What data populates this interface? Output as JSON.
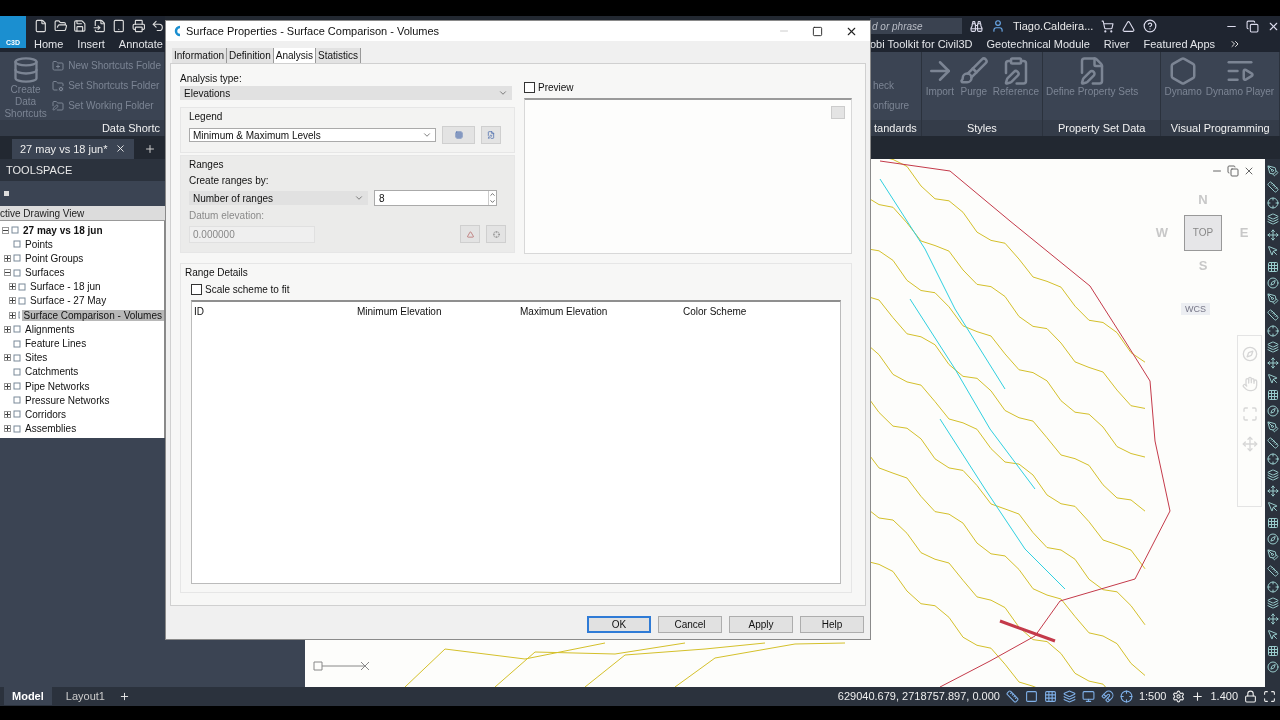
{
  "app": {
    "logo": "C3D",
    "ribbon_tabs_left": [
      {
        "label": "Home",
        "selected": false
      },
      {
        "label": "Insert",
        "selected": false
      },
      {
        "label": "Annotate",
        "selected": false
      }
    ],
    "search": {
      "placeholder": "d or phrase"
    },
    "user": "Tiago.Caldeira...",
    "ribbon_tabs_right": [
      {
        "label": "obi Toolkit for Civil3D",
        "selected": false
      },
      {
        "label": "Geotechnical Module",
        "selected": false
      },
      {
        "label": "River",
        "selected": false
      },
      {
        "label": "Featured Apps",
        "selected": false
      }
    ],
    "panel_left": {
      "title": "Data Shortc",
      "large": [
        {
          "label": "Create Data Shortcuts",
          "disabled": true
        }
      ],
      "small": [
        {
          "label": "New Shortcuts Folde",
          "disabled": true
        },
        {
          "label": "Set Shortcuts Folder",
          "disabled": true
        },
        {
          "label": "Set Working Folder",
          "disabled": true
        }
      ]
    },
    "panels_right": [
      {
        "title": "tandards",
        "kind": "small",
        "commands": [
          {
            "label": "heck",
            "disabled": true
          },
          {
            "label": "onfigure",
            "disabled": true
          }
        ]
      },
      {
        "title": "Styles",
        "kind": "large",
        "commands": [
          {
            "label": "Import",
            "disabled": true
          },
          {
            "label": "Purge",
            "disabled": true
          },
          {
            "label": "Reference",
            "disabled": true
          }
        ]
      },
      {
        "title": "Property Set Data",
        "kind": "large",
        "commands": [
          {
            "label": "Define Property Sets",
            "disabled": true
          }
        ]
      },
      {
        "title": "Visual Programming",
        "kind": "large",
        "commands": [
          {
            "label": "Dynamo",
            "disabled": true
          },
          {
            "label": "Dynamo Player",
            "disabled": true
          }
        ]
      }
    ]
  },
  "document_tabs": [
    {
      "label": "27 may vs 18 jun*",
      "selected": true
    }
  ],
  "toolspace": {
    "title": "TOOLSPACE",
    "view": "ctive Drawing View",
    "tree": [
      {
        "label": "27 may vs 18 jun",
        "selected": false,
        "expanded": true,
        "children": [
          {
            "label": "Points",
            "selected": false
          },
          {
            "label": "Point Groups",
            "selected": false,
            "expanded": false
          },
          {
            "label": "Surfaces",
            "selected": false,
            "expanded": true,
            "children": [
              {
                "label": "Surface - 18 jun",
                "selected": false,
                "expanded": false
              },
              {
                "label": "Surface - 27 May",
                "selected": false,
                "expanded": false
              },
              {
                "label": "Surface Comparison - Volumes",
                "selected": true,
                "expanded": false
              }
            ]
          },
          {
            "label": "Alignments",
            "selected": false,
            "expanded": false
          },
          {
            "label": "Feature Lines",
            "selected": false
          },
          {
            "label": "Sites",
            "selected": false,
            "expanded": false
          },
          {
            "label": "Catchments",
            "selected": false
          },
          {
            "label": "Pipe Networks",
            "selected": false,
            "expanded": false
          },
          {
            "label": "Pressure Networks",
            "selected": false
          },
          {
            "label": "Corridors",
            "selected": false,
            "expanded": false
          },
          {
            "label": "Assemblies",
            "selected": false,
            "expanded": false
          }
        ]
      }
    ]
  },
  "viewcube": {
    "north": "N",
    "west": "W",
    "east": "E",
    "south": "S",
    "face": "TOP",
    "ucs": "WCS"
  },
  "layout_tabs": [
    {
      "label": "Model",
      "selected": true
    },
    {
      "label": "Layout1",
      "selected": false
    }
  ],
  "status_bar": {
    "coordinates": "629040.679, 2718757.897, 0.000",
    "scale": "1:500",
    "readout": "1.400"
  },
  "dialog": {
    "title": "Surface Properties - Surface Comparison - Volumes",
    "tabs": [
      {
        "label": "Information",
        "selected": false
      },
      {
        "label": "Definition",
        "selected": false
      },
      {
        "label": "Analysis",
        "selected": true
      },
      {
        "label": "Statistics",
        "selected": false
      }
    ],
    "analysis_type": {
      "label": "Analysis type:",
      "value": "Elevations"
    },
    "legend": {
      "label": "Legend",
      "value": "Minimum & Maximum Levels"
    },
    "ranges": {
      "label": "Ranges",
      "create_by_label": "Create ranges by:",
      "create_by_value": "Number of ranges",
      "count": "8",
      "datum_label": "Datum elevation:",
      "datum_value": "0.000000",
      "datum_disabled": true
    },
    "preview": {
      "label": "Preview",
      "checked": false
    },
    "range_details": {
      "label": "Range Details",
      "scale_to_fit": {
        "label": "Scale scheme to fit",
        "checked": false
      },
      "columns": [
        "ID",
        "Minimum Elevation",
        "Maximum Elevation",
        "Color Scheme"
      ]
    },
    "buttons": [
      {
        "label": "OK",
        "default": true
      },
      {
        "label": "Cancel",
        "default": false
      },
      {
        "label": "Apply",
        "default": false
      },
      {
        "label": "Help",
        "default": false
      }
    ]
  }
}
